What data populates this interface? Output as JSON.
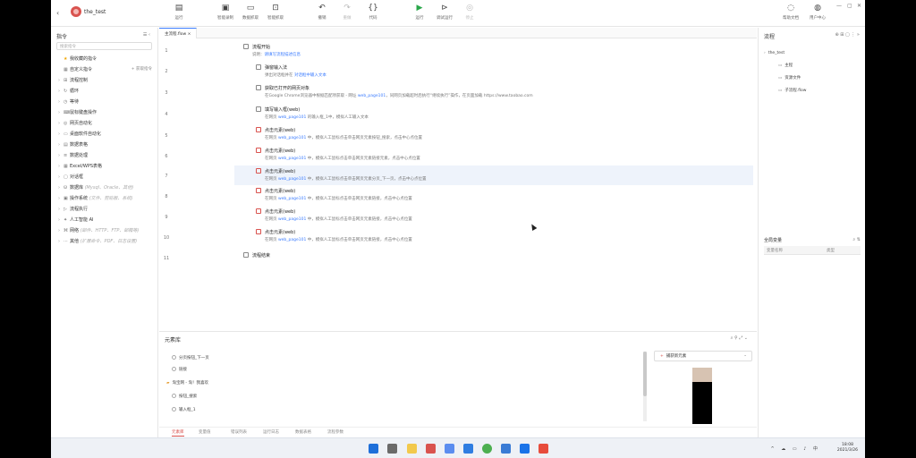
{
  "titlebar": {
    "project_name": "the_test",
    "tools": [
      {
        "id": "run-config",
        "label": "运行",
        "icon": "menu-icon"
      },
      {
        "id": "record",
        "label": "智能录制",
        "icon": "record-icon"
      },
      {
        "id": "data-capture",
        "label": "数据抓取",
        "icon": "capture-icon"
      },
      {
        "id": "web-capture",
        "label": "智能抓取",
        "icon": "web-capture-icon"
      },
      {
        "id": "undo",
        "label": "撤销",
        "icon": "undo-icon"
      },
      {
        "id": "redo",
        "label": "重做",
        "icon": "redo-icon"
      },
      {
        "id": "code",
        "label": "代码",
        "icon": "code-icon"
      },
      {
        "id": "run",
        "label": "运行",
        "icon": "play-icon"
      },
      {
        "id": "debug",
        "label": "调试运行",
        "icon": "debug-icon"
      },
      {
        "id": "stop",
        "label": "停止",
        "icon": "stop-icon"
      }
    ],
    "right_tools": [
      {
        "label": "帮助文档",
        "icon": "help-icon"
      },
      {
        "label": "用户中心",
        "icon": "user-icon"
      }
    ]
  },
  "left": {
    "title": "指令",
    "search_placeholder": "搜索指令",
    "items": [
      {
        "label": "我收藏的指令",
        "caret": "",
        "icon": "★"
      },
      {
        "label": "自定义指令",
        "caret": "",
        "icon": "▦",
        "action": "+ 获取指令"
      },
      {
        "label": "流程控制",
        "caret": "›",
        "icon": "⊞"
      },
      {
        "label": "循环",
        "caret": "›",
        "icon": "↻"
      },
      {
        "label": "等待",
        "caret": "›",
        "icon": "◷"
      },
      {
        "label": "鼠标键盘操作",
        "caret": "›",
        "icon": "⌨"
      },
      {
        "label": "网页自动化",
        "caret": "›",
        "icon": "◎"
      },
      {
        "label": "桌面软件自动化",
        "caret": "›",
        "icon": "▭"
      },
      {
        "label": "数据表格",
        "caret": "›",
        "icon": "▤"
      },
      {
        "label": "数据处理",
        "caret": "›",
        "icon": "≡"
      },
      {
        "label": "Excel/WPS表格",
        "caret": "›",
        "icon": "▦"
      },
      {
        "label": "对话框",
        "caret": "›",
        "icon": "▢"
      },
      {
        "label": "数据库",
        "caret": "›",
        "icon": "⛁",
        "sub": "(Mysql、Oracle、其他)"
      },
      {
        "label": "操作系统",
        "caret": "›",
        "icon": "▣",
        "sub": "(文件、剪贴板、系统)"
      },
      {
        "label": "流程执行",
        "caret": "›",
        "icon": "▷"
      },
      {
        "label": "人工智能 AI",
        "caret": "›",
        "icon": "✦"
      },
      {
        "label": "网络",
        "caret": "›",
        "icon": "⌘",
        "sub": "(邮件、HTTP、FTP、邮箱等)"
      },
      {
        "label": "其他",
        "caret": "›",
        "icon": "⋯",
        "sub": "(扩展命令、PDF、日志设置)"
      }
    ]
  },
  "center": {
    "tab_label": "主流程.flow",
    "lines": [
      "1",
      "2",
      "3",
      "4",
      "5",
      "6",
      "7",
      "8",
      "9",
      "10",
      "11"
    ],
    "steps": [
      {
        "title": "流程开始",
        "desc_plain": "说明：",
        "desc_hl": "请填写流程描述信息"
      },
      {
        "title": "弹窗输入法",
        "desc_plain": "弹出对话框并在 ",
        "desc_hl": "对话框中输入文本"
      },
      {
        "title": "获取已打开的网页对象",
        "desc_plain": "在Google Chrome浏览器中根据匹配项获取 - 网址 ",
        "desc_hl": "web_page101",
        "desc_tail": "，同网页加载超时后执行“继续执行”操作，在页面加载 https://www.taobao.com"
      },
      {
        "title": "填写输入框(web)",
        "desc_plain": "在网页 ",
        "desc_hl": "web_page101",
        "desc_tail": " 的输入框_1中，模拟人工输入文本"
      },
      {
        "title": "点击元素(web)",
        "desc_plain": "在网页 ",
        "desc_hl": "web_page101",
        "desc_tail": " 中，模拟人工鼠标点击单击网页元素按钮_搜索，点击中心点位置"
      },
      {
        "title": "点击元素(web)",
        "desc_plain": "在网页 ",
        "desc_hl": "web_page101",
        "desc_tail": " 中，模拟人工鼠标点击单击网页元素链接元素，点击中心点位置"
      },
      {
        "title": "点击元素(web)",
        "desc_plain": "在网页 ",
        "desc_hl": "web_page101",
        "desc_tail": " 中，模拟人工鼠标点击单击网页元素分页_下一页，点击中心点位置"
      },
      {
        "title": "点击元素(web)",
        "desc_plain": "在网页 ",
        "desc_hl": "web_page101",
        "desc_tail": " 中，模拟人工鼠标点击单击网页元素链接，点击中心点位置"
      },
      {
        "title": "点击元素(web)",
        "desc_plain": "在网页 ",
        "desc_hl": "web_page101",
        "desc_tail": " 中，模拟人工鼠标点击单击网页元素链接，点击中心点位置"
      },
      {
        "title": "点击元素(web)",
        "desc_plain": "在网页 ",
        "desc_hl": "web_page101",
        "desc_tail": " 中，模拟人工鼠标点击单击网页元素链接，点击中心点位置"
      },
      {
        "title": "流程结束",
        "desc_plain": "",
        "desc_hl": ""
      }
    ]
  },
  "library": {
    "title": "元素库",
    "items": [
      {
        "type": "el",
        "label": "分页按钮_下一页"
      },
      {
        "type": "el",
        "label": "链接"
      },
      {
        "type": "folder",
        "label": "淘宝网 - 淘！我喜欢"
      },
      {
        "type": "el",
        "label": "按钮_搜索"
      },
      {
        "type": "el",
        "label": "输入框_1"
      }
    ],
    "capture_label": "捕获新元素",
    "tabs": [
      "元素库",
      "变量值",
      "错误列表",
      "运行日志",
      "数据表格",
      "流程参数"
    ]
  },
  "right": {
    "title": "流程",
    "tree": [
      {
        "label": "the_test",
        "icon": "›"
      },
      {
        "label": "主程",
        "icon": "▭"
      },
      {
        "label": "资源文件",
        "icon": "▭"
      },
      {
        "label": "子流程.flow",
        "icon": "▭"
      }
    ],
    "vars_title": "全局变量",
    "vars_cols": [
      "变量名称",
      "类型"
    ]
  },
  "taskbar": {
    "time": "18:08",
    "date": "2021/3/26",
    "tray": "^ ☁ ▭ ♪ 中"
  },
  "colors": {
    "accent": "#3b7cff",
    "brand": "#d9534f",
    "run": "#2aa74a"
  }
}
